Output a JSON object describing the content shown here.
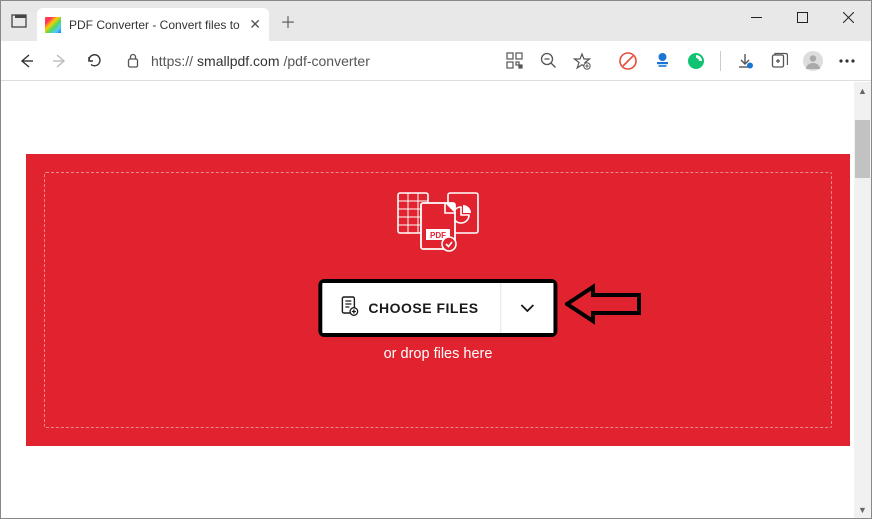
{
  "browser": {
    "tab_title": "PDF Converter - Convert files to ",
    "url_prefix": "https://",
    "url_domain": "smallpdf.com",
    "url_path": "/pdf-converter"
  },
  "page": {
    "choose_files_label": "CHOOSE FILES",
    "drop_hint": "or drop files here"
  }
}
